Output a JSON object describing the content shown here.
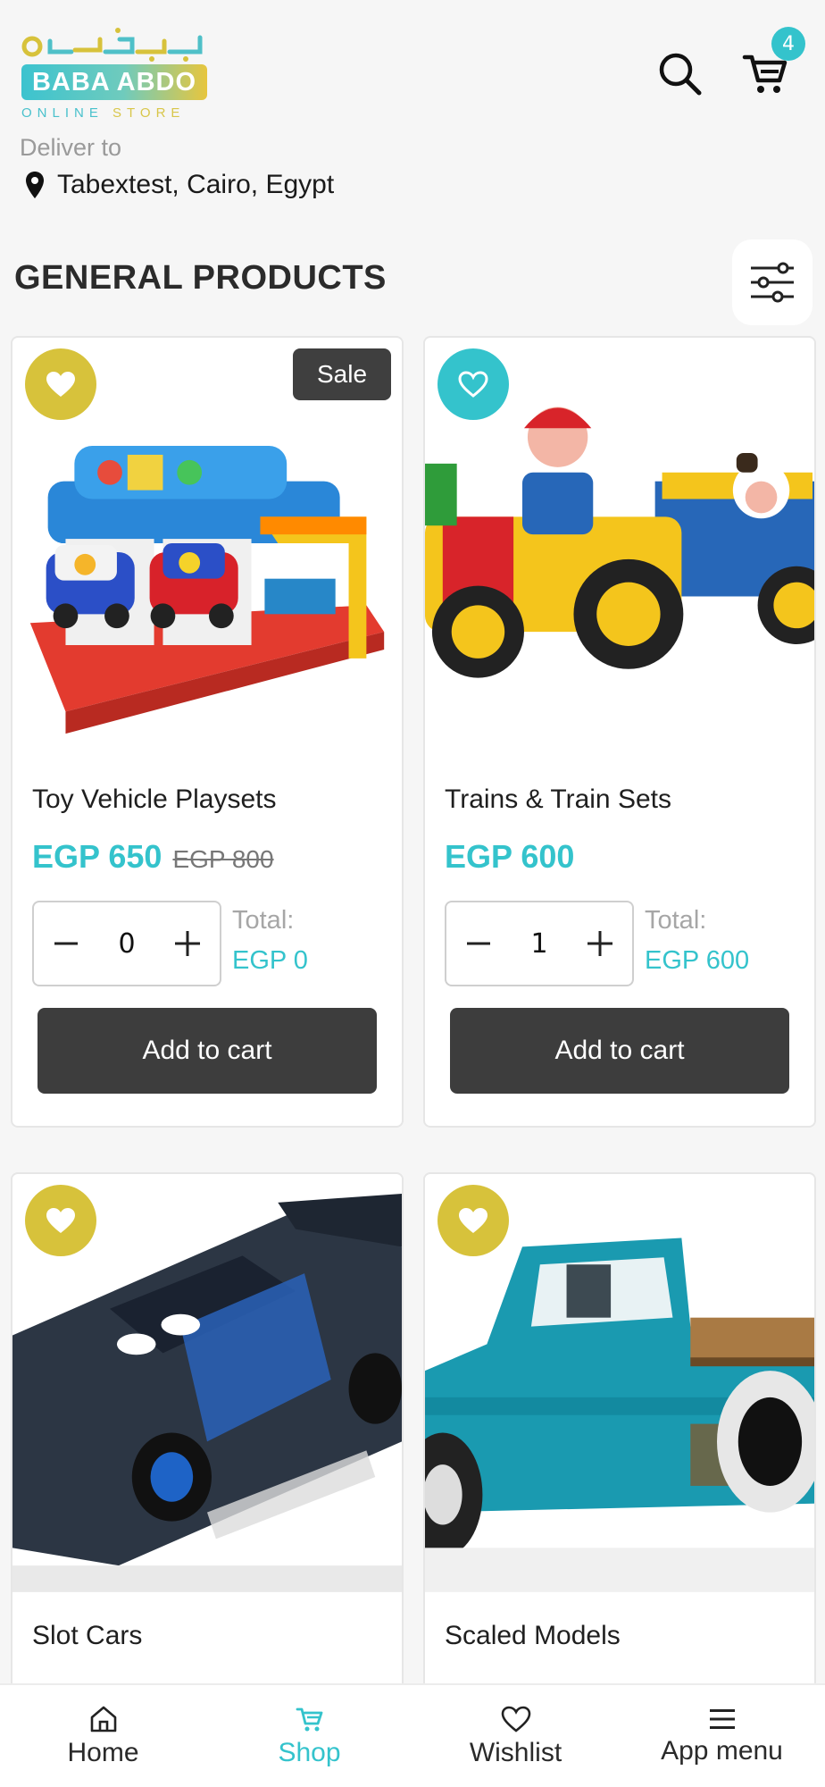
{
  "header": {
    "logo": {
      "arabic_text": "بابا عبدو",
      "brand": "BABA ABDO",
      "tagline_part1": "ONLINE",
      "tagline_part2": "STORE"
    },
    "cart_count": "4",
    "deliver_label": "Deliver to",
    "location": "Tabextest, Cairo, Egypt"
  },
  "section": {
    "title": "GENERAL PRODUCTS"
  },
  "products": [
    {
      "name": "Toy Vehicle Playsets",
      "price": "EGP 650",
      "old_price": "EGP 800",
      "badge": "Sale",
      "quantity": "0",
      "total_label": "Total:",
      "total_value": "EGP 0",
      "button": "Add to cart",
      "favorite": false
    },
    {
      "name": "Trains & Train Sets",
      "price": "EGP 600",
      "quantity": "1",
      "total_label": "Total:",
      "total_value": "EGP 600",
      "button": "Add to cart",
      "favorite": true
    },
    {
      "name": "Slot Cars",
      "favorite": false
    },
    {
      "name": "Scaled Models",
      "favorite": false
    }
  ],
  "nav": {
    "items": [
      {
        "label": "Home",
        "icon": "home-icon"
      },
      {
        "label": "Shop",
        "icon": "cart-icon"
      },
      {
        "label": "Wishlist",
        "icon": "heart-icon"
      },
      {
        "label": "App menu",
        "icon": "menu-icon"
      }
    ],
    "active": "Shop"
  },
  "colors": {
    "accent": "#34c3cc",
    "favorite_yellow": "#d7c23b",
    "button_dark": "#3d3d3d",
    "background": "#f6f6f6"
  }
}
